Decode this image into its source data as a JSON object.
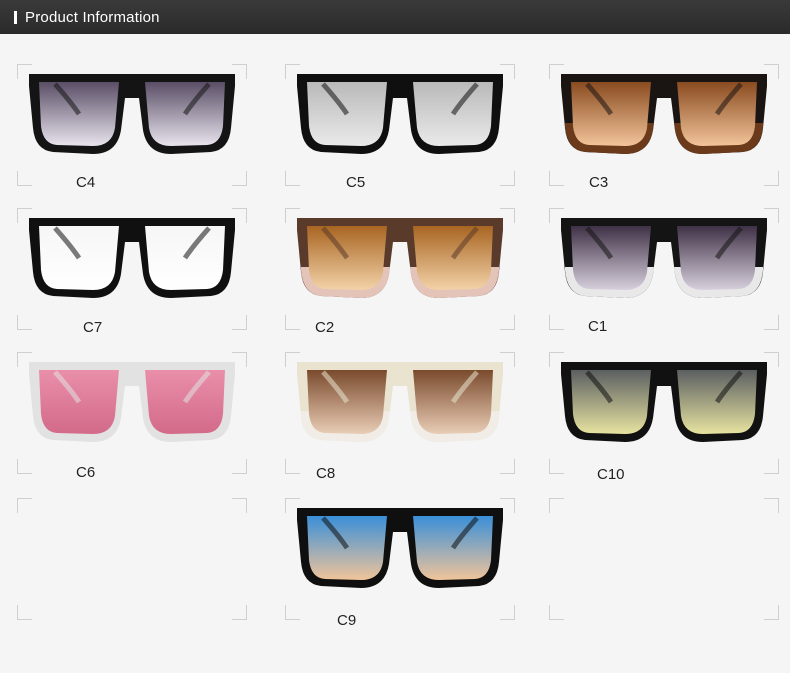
{
  "header": {
    "title": "Product Information"
  },
  "colors": {
    "header_bg": "#2f2f2f",
    "panel_bg": "#f5f5f5"
  },
  "variants": [
    {
      "code": "C4",
      "frame": "#141414",
      "lens_top": "#5a4e66",
      "lens_bottom": "#e9e4ee"
    },
    {
      "code": "C5",
      "frame": "#0f0f0f",
      "lens_top": "#b9b9b9",
      "lens_bottom": "#eaeaea"
    },
    {
      "code": "C3",
      "frame": "#1a1412",
      "lens_top": "#8a4b20",
      "lens_bottom": "#f2c49a",
      "bottom_frame": "#6b3a1a"
    },
    {
      "code": "C7",
      "frame": "#101010",
      "lens_top": "#f6f6f6",
      "lens_bottom": "#ffffff"
    },
    {
      "code": "C2",
      "frame": "#5a3a2a",
      "lens_top": "#a86522",
      "lens_bottom": "#f3d2a8",
      "bottom_frame": "#e4c4b8"
    },
    {
      "code": "C1",
      "frame": "#141414",
      "lens_top": "#3f3146",
      "lens_bottom": "#d8d0dd",
      "bottom_frame": "#e8e8e8"
    },
    {
      "code": "C6",
      "frame": "#e2e2e2",
      "lens_top": "#e98fa9",
      "lens_bottom": "#d36a8a"
    },
    {
      "code": "C8",
      "frame": "#e9e3cf",
      "lens_top": "#7a4a2c",
      "lens_bottom": "#e9cdb6",
      "bottom_frame": "#f1ede6"
    },
    {
      "code": "C10",
      "frame": "#111111",
      "lens_top": "#5b5f60",
      "lens_bottom": "#e7e3a0"
    },
    {
      "code": "",
      "frame": "",
      "lens_top": "",
      "lens_bottom": ""
    },
    {
      "code": "C9",
      "frame": "#0f0f0f",
      "lens_top": "#3a8fd8",
      "lens_bottom": "#f0c49a"
    },
    {
      "code": "",
      "frame": "",
      "lens_top": "",
      "lens_bottom": ""
    }
  ]
}
